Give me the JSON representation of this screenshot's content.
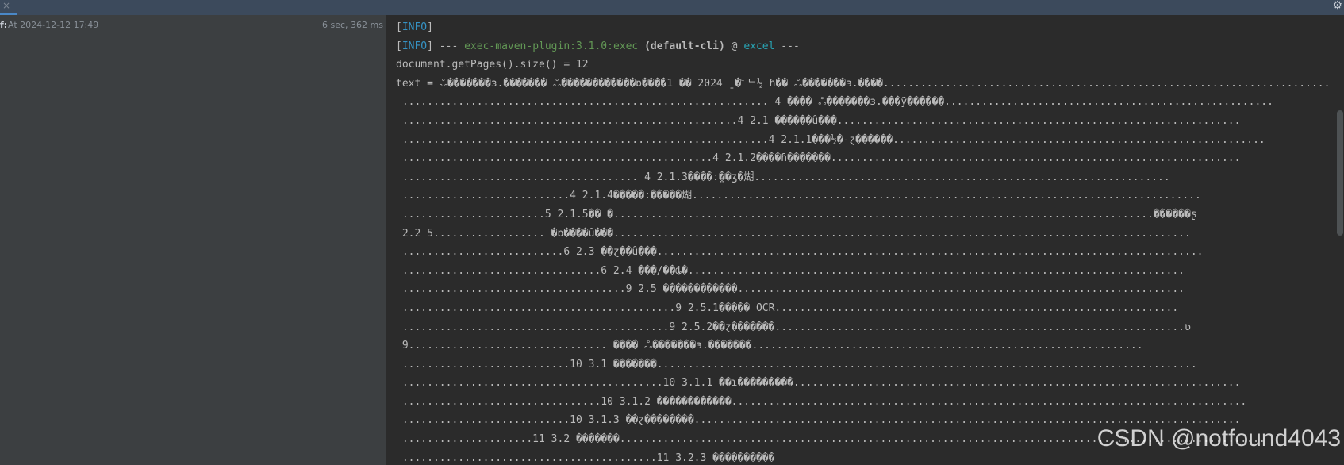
{
  "toolbar": {
    "close_icon": "×",
    "gear_icon": "⚙"
  },
  "run_panel": {
    "status_icon": "f:",
    "label": "At 2024-12-12 17:49",
    "duration": "6 sec, 362 ms"
  },
  "console": {
    "lines": [
      {
        "level": "INFO",
        "text": ""
      },
      {
        "level": "INFO",
        "sep1": " --- ",
        "plugin": "exec-maven-plugin:3.1.0:exec",
        "cli": " (default-cli)",
        "at": " @ ",
        "project": "excel",
        "sep2": " ---"
      },
      {
        "text": "document.getPages().size() = 12"
      },
      {
        "text": "text = ஃ�������ɜ.������� ஃ������������ɒ����1 �� 2024 ˍ�҇ ᄂ½ ɦ�� ஃ�������ɜ.����........................................................................."
      },
      {
        "text": " ........................................................... 4 ���� ஃ�������ɜ.���ÿ������....................................................."
      },
      {
        "text": " ......................................................4 2.1 ������ȗ���................................................................."
      },
      {
        "text": " ...........................................................4 2.1.1���½�-ɀ������............................................................"
      },
      {
        "text": " ..................................................4 2.1.2����ɦ�������.................................................................."
      },
      {
        "text": " ...................................... 4 2.1.3����ː̤��ʒ�煳..................................................................."
      },
      {
        "text": " ...........................4 2.1.4�����:�����煳.................................................................................."
      },
      {
        "text": " .......................5 2.1.5�� �.......................................................................................������ʂ"
      },
      {
        "text": " 2.2 5.................. �ɒ����ȗ���............................................................................................."
      },
      {
        "text": " ..........................6 2.3 ��ɀ��ȗ���........................................................................................"
      },
      {
        "text": " ................................6 2.4 ���/��ȡ�................................................................................"
      },
      {
        "text": " ....................................9 2.5 ������������........................................................................"
      },
      {
        "text": " ............................................9 2.5.1����� OCR................................................................."
      },
      {
        "text": " ...........................................9 2.5.2��ɀ������҇�..................................................................ʋ"
      },
      {
        "text": " 9................................ ���� ஃ�������ɜ.�������..............................................................."
      },
      {
        "text": " ...........................10 3.1 �������......................................................................................."
      },
      {
        "text": " ..........................................10 3.1.1 ��ɿ���������........................................................................"
      },
      {
        "text": " ................................10 3.1.2 ������������..................................................................................."
      },
      {
        "text": " ...........................10 3.1.3 ��ɀ��������........................................................................................"
      },
      {
        "text": " .....................11 3.2 �������........................................................................................................"
      },
      {
        "text": " .........................................11 3.2.3 ����������"
      }
    ]
  },
  "watermark": {
    "text": "CSDN @notfound4043"
  },
  "colors": {
    "info": "#3592c4",
    "plugin": "#629755",
    "project": "#28a3b3",
    "text": "#bbbbbb",
    "background": "#2b2b2b",
    "sidebar": "#3c3f41",
    "topbar": "#3c4a5c"
  }
}
